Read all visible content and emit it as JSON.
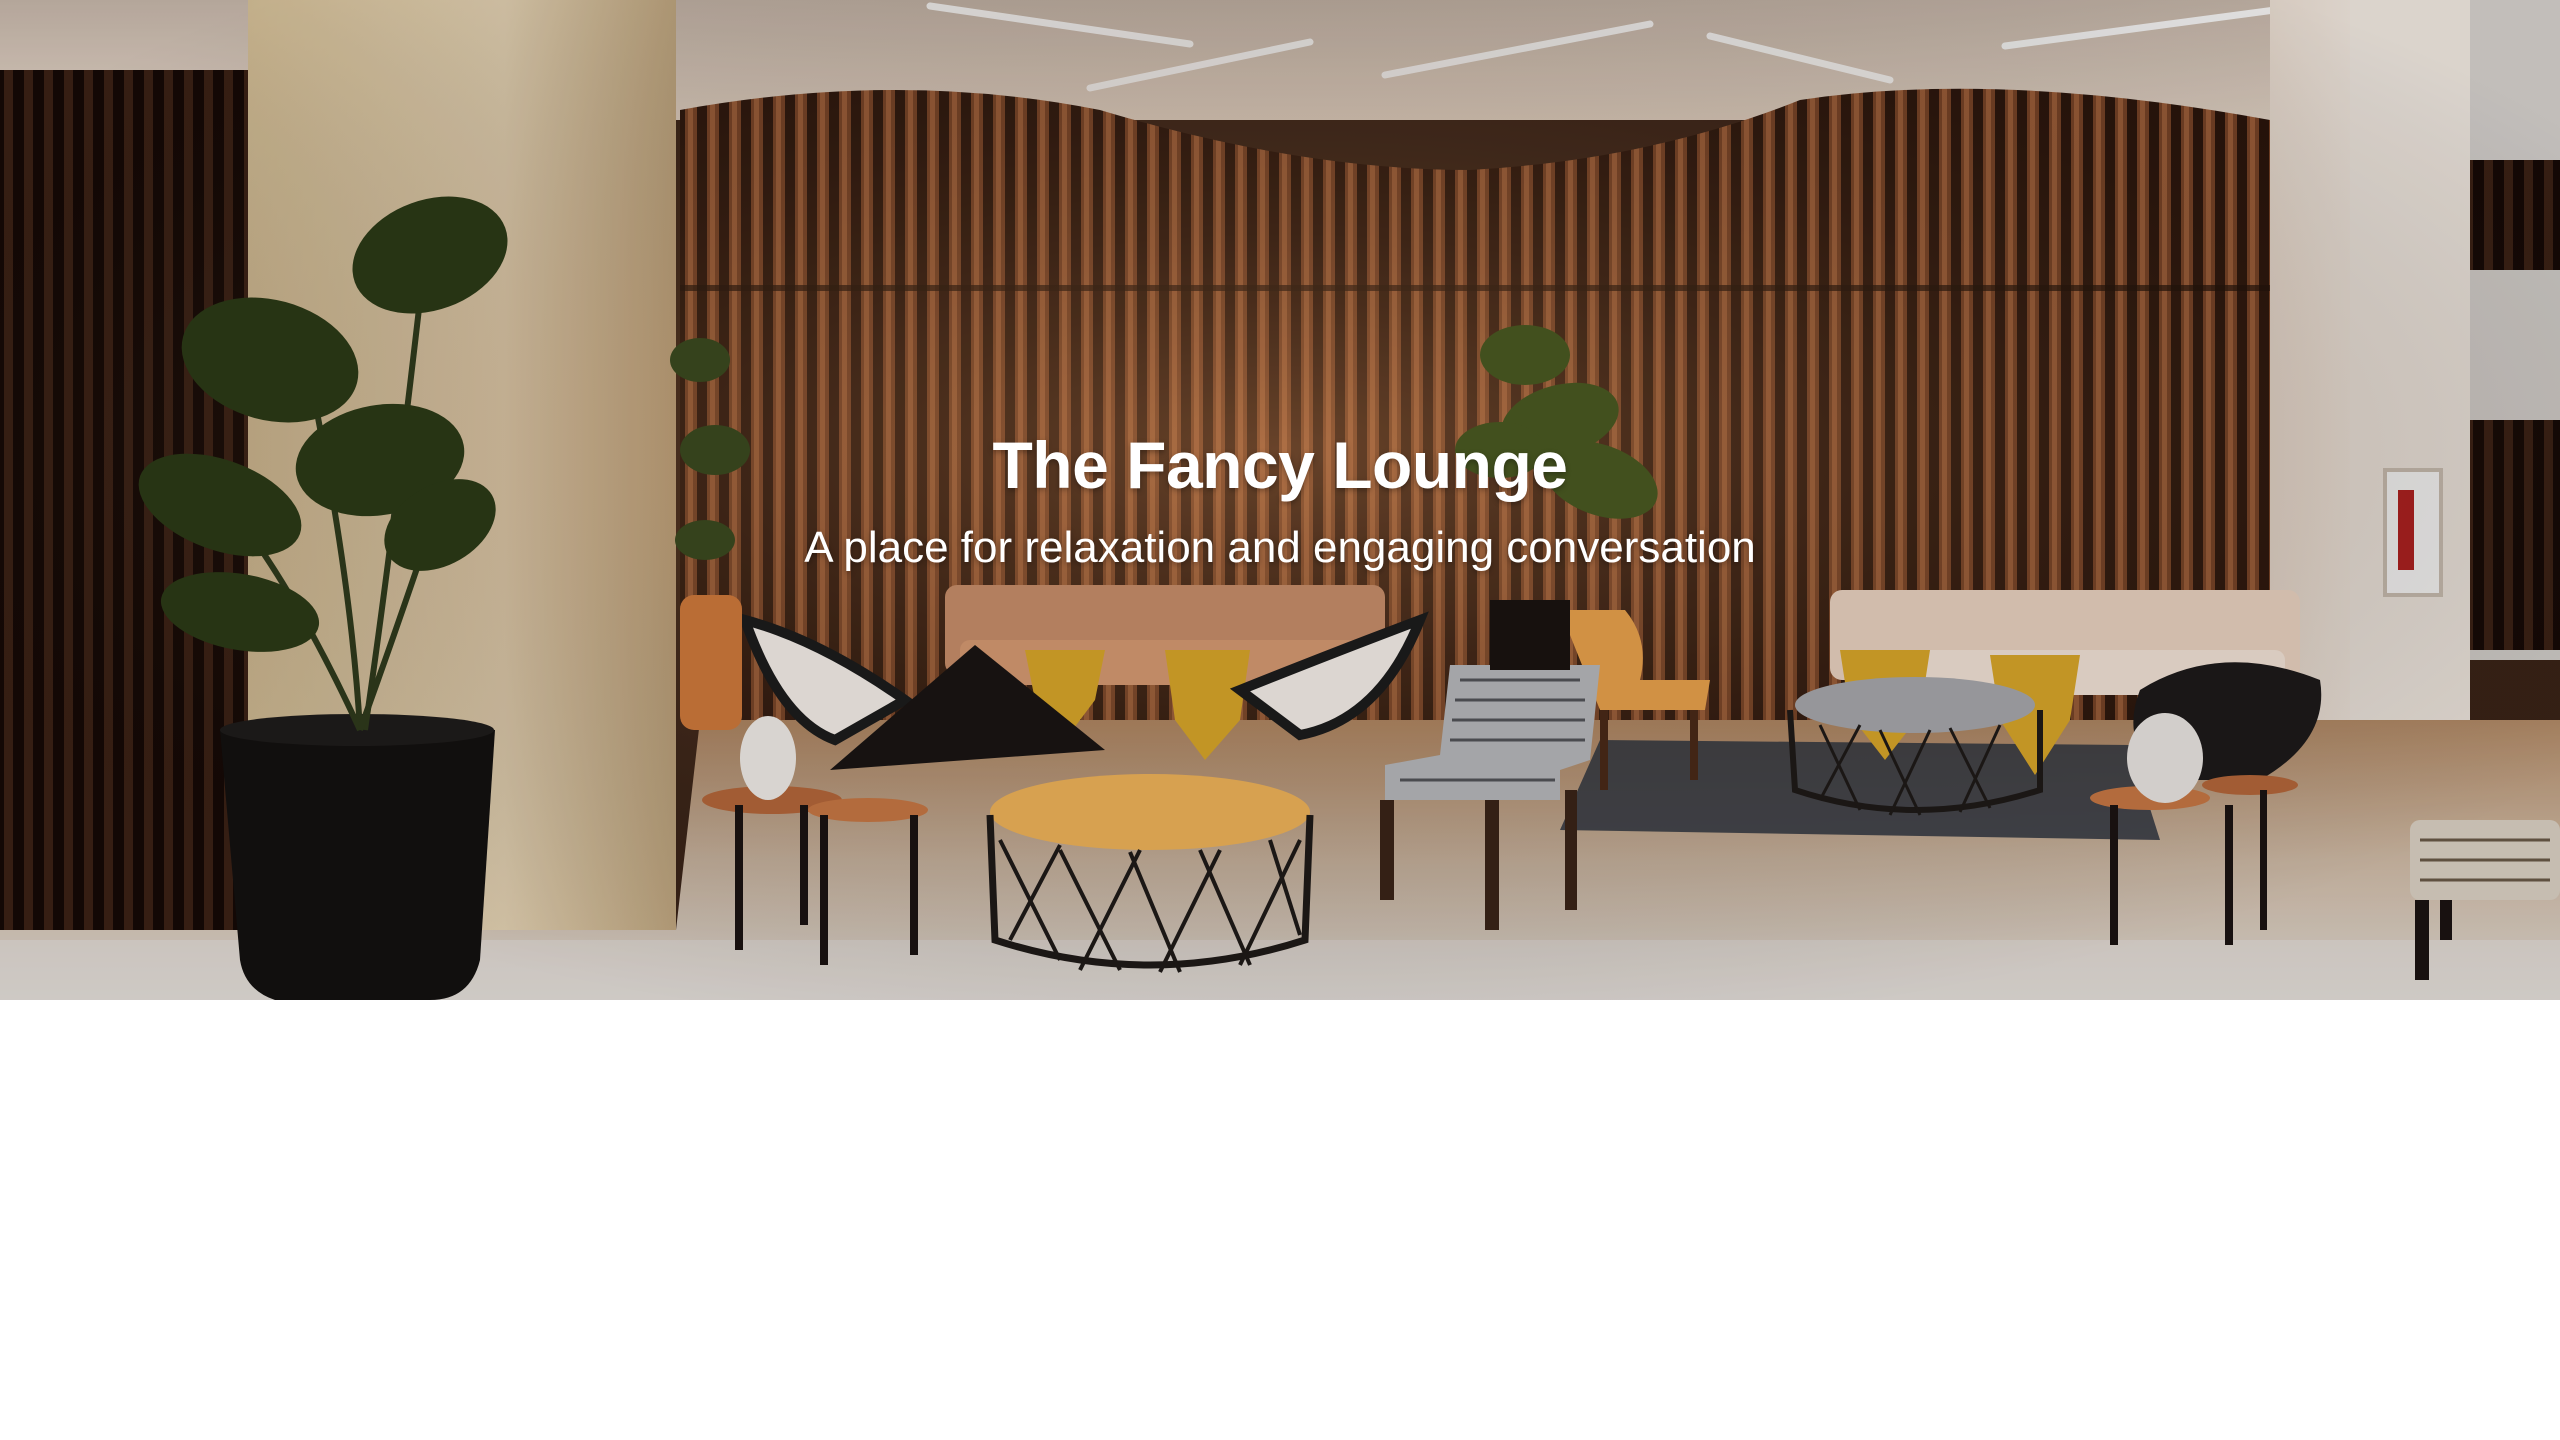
{
  "hero": {
    "title": "The Fancy Lounge",
    "subtitle": "A place for relaxation and engaging conversation",
    "background_image": "lounge-interior-photo"
  },
  "colors": {
    "title_text": "#ffffff",
    "page_background": "#ffffff",
    "wall_wood": "#5a301c",
    "floor": "#d8cfc4",
    "accent_gold": "#d9a62a"
  }
}
